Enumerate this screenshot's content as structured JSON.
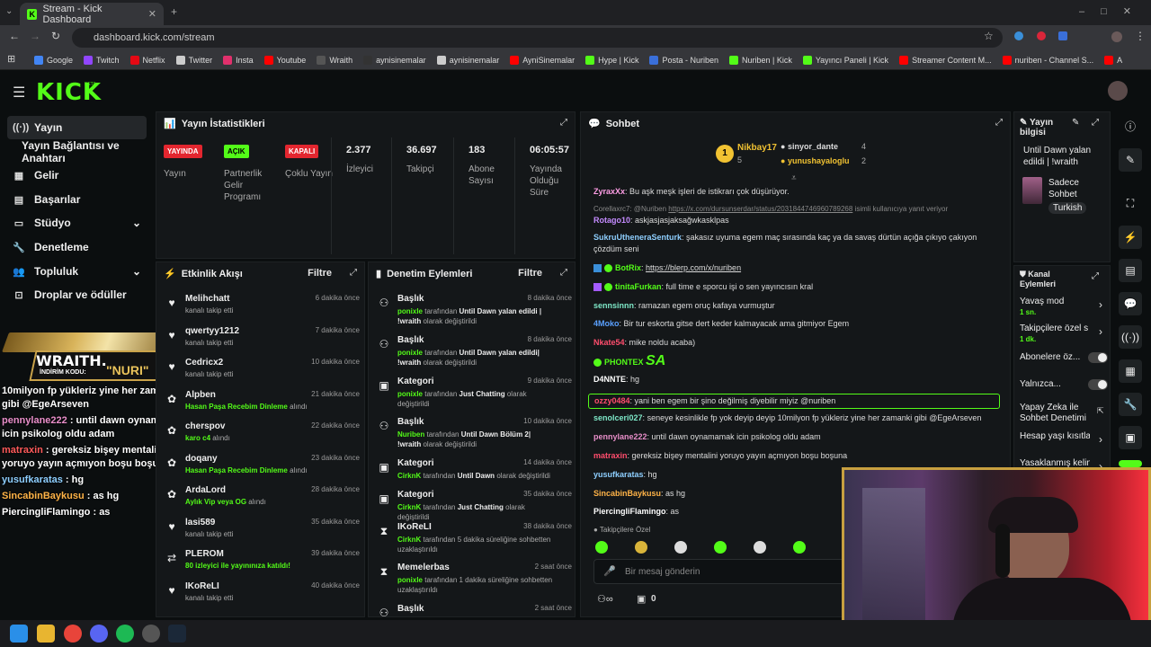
{
  "browser": {
    "tab_title": "Stream - Kick Dashboard",
    "url": "dashboard.kick.com/stream",
    "bookmarks": [
      "Google",
      "Twitch",
      "Netflix",
      "Twitter",
      "Insta",
      "Youtube",
      "Wraith",
      "aynisinemalar",
      "aynisinemalar",
      "AyniSinemalar",
      "Hype | Kick",
      "Posta - Nuriben",
      "Nuriben | Kick",
      "Yayıncı Paneli | Kick",
      "Streamer Content M...",
      "nuriben - Channel S...",
      "Aynı Sinemalar - Ça..."
    ]
  },
  "brand": {
    "logo": "KICK",
    "beta": "BETA",
    "accent": "#53fc18"
  },
  "sidebar": {
    "items": [
      {
        "label": "Yayın",
        "icon": "broadcast-icon"
      },
      {
        "label": "Yayın Bağlantısı ve Anahtarı"
      },
      {
        "label": "Gelir",
        "icon": "revenue-icon"
      },
      {
        "label": "Başarılar",
        "icon": "achievements-icon"
      },
      {
        "label": "Stüdyo",
        "icon": "studio-icon"
      },
      {
        "label": "Denetleme",
        "icon": "moderation-icon"
      },
      {
        "label": "Topluluk",
        "icon": "community-icon"
      },
      {
        "label": "Droplar ve ödüller",
        "icon": "drops-icon"
      }
    ]
  },
  "overlay": {
    "banner_brand": "WRAITH.",
    "banner_code_label": "İNDİRİM KODU:",
    "banner_code": "\"NURI\"",
    "chat": [
      {
        "user": "",
        "text": "10milyon fp yükleriz yine her zamanki gibi @EgeArseven",
        "color": "#ffffff"
      },
      {
        "user": "pennylane222",
        "text": "until dawn oynamamak icin psikolog oldu adam",
        "color": "#e88ec9"
      },
      {
        "user": "matraxin",
        "text": "gereksiz bişey mentalini yoruyo yayın açmıyon boşu boşuna",
        "color": "#ff5a5a"
      },
      {
        "user": "yusufkaratas",
        "text": "hg",
        "color": "#8ecfff"
      },
      {
        "user": "SincabinBaykusu",
        "text": "as hg",
        "color": "#ffb347"
      },
      {
        "user": "PiercingliFlamingo",
        "text": "as",
        "color": "#ffffff"
      }
    ]
  },
  "stats": {
    "title": "Yayın İstatistikleri",
    "badges": [
      {
        "text": "YAYINDA",
        "label": "Yayın",
        "color": "#e3262f"
      },
      {
        "text": "AÇIK",
        "label": "Partnerlik Gelir Programı",
        "color": "#53fc18"
      },
      {
        "text": "KAPALI",
        "label": "Çoklu Yayın",
        "color": "#e3262f"
      }
    ],
    "values": [
      {
        "value": "2.377",
        "label": "İzleyici"
      },
      {
        "value": "36.697",
        "label": "Takipçi"
      },
      {
        "value": "183",
        "label": "Abone Sayısı"
      },
      {
        "value": "06:05:57",
        "label": "Yayında Olduğu Süre"
      }
    ]
  },
  "activity": {
    "title": "Etkinlik Akışı",
    "filter": "Filtre",
    "rows": [
      {
        "name": "Melihchatt",
        "time": "6 dakika önce",
        "sub": "kanalı takip etti",
        "icon": "heart-icon"
      },
      {
        "name": "qwertyy1212",
        "time": "7 dakika önce",
        "sub": "kanalı takip etti",
        "icon": "heart-icon"
      },
      {
        "name": "Cedricx2",
        "time": "10 dakika önce",
        "sub": "kanalı takip etti",
        "icon": "heart-icon"
      },
      {
        "name": "Alpben",
        "time": "21 dakika önce",
        "sub_g": "Hasan Paşa Recebim Dinleme",
        "sub": "alındı",
        "icon": "gift-icon"
      },
      {
        "name": "cherspov",
        "time": "22 dakika önce",
        "sub_g": "karo c4",
        "sub": "alındı",
        "icon": "gift-icon"
      },
      {
        "name": "doqany",
        "time": "23 dakika önce",
        "sub_g": "Hasan Paşa Recebim Dinleme",
        "sub": "alındı",
        "icon": "gift-icon"
      },
      {
        "name": "ArdaLord",
        "time": "28 dakika önce",
        "sub_g": "Aylık Vip veya OG",
        "sub": "alındı",
        "icon": "gift-icon"
      },
      {
        "name": "lasi589",
        "time": "35 dakika önce",
        "sub": "kanalı takip etti",
        "icon": "heart-icon"
      },
      {
        "name": "PLEROM",
        "time": "39 dakika önce",
        "sub_g": "80 izleyici ile yayınınıza katıldı!",
        "sub": "",
        "icon": "host-icon"
      },
      {
        "name": "IKoReLI",
        "time": "40 dakika önce",
        "sub": "kanalı takip etti",
        "icon": "heart-icon"
      }
    ]
  },
  "modlog": {
    "title": "Denetim Eylemleri",
    "filter": "Filtre",
    "rows": [
      {
        "name": "Başlık",
        "time": "8 dakika önce",
        "by": "ponixle",
        "mid": "tarafından",
        "val": "Until Dawn yalan edildi | !wraith",
        "tail": "olarak değiştirildi",
        "icon": "title-icon"
      },
      {
        "name": "Başlık",
        "time": "8 dakika önce",
        "by": "ponixle",
        "mid": "tarafından",
        "val": "Until Dawn yalan edildi| !wraith",
        "tail": "olarak değiştirildi",
        "icon": "title-icon"
      },
      {
        "name": "Kategori",
        "time": "9 dakika önce",
        "by": "ponixle",
        "mid": "tarafından",
        "val": "Just Chatting",
        "tail": "olarak değiştirildi",
        "icon": "category-icon"
      },
      {
        "name": "Başlık",
        "time": "10 dakika önce",
        "by": "Nuriben",
        "mid": "tarafından",
        "val": "Until Dawn Bölüm 2| !wraith",
        "tail": "olarak değiştirildi",
        "icon": "title-icon"
      },
      {
        "name": "Kategori",
        "time": "14 dakika önce",
        "by": "CirknK",
        "mid": "tarafından",
        "val": "Until Dawn",
        "tail": "olarak değiştirildi",
        "icon": "category-icon"
      },
      {
        "name": "Kategori",
        "time": "35 dakika önce",
        "by": "CirknK",
        "mid": "tarafından",
        "val": "Just Chatting",
        "tail": "olarak değiştirildi",
        "icon": "category-icon"
      },
      {
        "name": "IKoReLI",
        "time": "38 dakika önce",
        "by": "CirknK",
        "mid": "tarafından 5 dakika süreliğine sohbetten uzaklaştırıldı",
        "val": "",
        "tail": "",
        "icon": "timeout-icon"
      },
      {
        "name": "Memelerbas",
        "time": "2 saat önce",
        "by": "ponixle",
        "mid": "tarafından 1 dakika süreliğine sohbetten uzaklaştırıldı",
        "val": "",
        "tail": "",
        "icon": "timeout-icon"
      },
      {
        "name": "Başlık",
        "time": "2 saat önce",
        "by": "",
        "mid": "",
        "val": "",
        "tail": "",
        "icon": "title-icon"
      }
    ]
  },
  "chat": {
    "title": "Sohbet",
    "top_gifter": {
      "rank": "1",
      "name": "Nikbay17",
      "count": "5"
    },
    "gifters": [
      {
        "name": "sinyor_dante",
        "count": "4"
      },
      {
        "name": "yunushayaloglu",
        "count": "2"
      }
    ],
    "reply_hint": "Corellaxrc7: @Nuriben",
    "reply_link": "https://x.com/dursunserdar/status/2031844746960789268",
    "reply_tail": "isimli kullanıcıya yanıt veriyor",
    "messages": [
      {
        "user": "ZyraxXx",
        "text": "Bu aşk meşk işleri de istikrarı çok düşürüyor.",
        "color": "#ff9ee6"
      },
      {
        "user": "Rotago10",
        "text": "askjasjasjaksağwkasklpas",
        "color": "#c48bff"
      },
      {
        "user": "SukruUtheneraSenturk",
        "text": "şakasız uyuma egem maç sırasında kaç ya da savaş dürtün açığa çıkıyo çakıyon çözdüm seni",
        "color": "#8ecfff"
      },
      {
        "user": "BotRix",
        "text": "https://blerp.com/x/nuriben",
        "color": "#53fc18"
      },
      {
        "user": "tinitaFurkan",
        "text": "full time e sporcu işi o sen yayıncısın kral",
        "color": "#53fc18"
      },
      {
        "user": "sennsinnn",
        "text": "ramazan egem oruç kafaya vurmuştur",
        "color": "#7ee8c8"
      },
      {
        "user": "4Moko",
        "text": "Bir tur eskorta gitse dert keder kalmayacak ama gitmiyor Egem",
        "color": "#5aa0ff"
      },
      {
        "user": "Nkate54",
        "text": "mike noldu acaba)",
        "color": "#ff4d6d"
      },
      {
        "user": "PHONTEX",
        "text": "SA",
        "color": "#53fc18"
      },
      {
        "user": "D4NNTE",
        "text": "hg",
        "color": "#ffffff"
      },
      {
        "user": "ozzy0484",
        "text": "yani ben egem bir şino değilmiş diyebilir miyiz @nuriben",
        "color": "#ff4d6d"
      },
      {
        "user": "senolceri027",
        "text": "seneye kesinlikle fp yok deyip deyip 10milyon fp yükleriz yine her zamanki gibi @EgeArseven",
        "color": "#7ee8c8"
      },
      {
        "user": "pennylane222",
        "text": "until dawn oynamamak icin psikolog oldu adam",
        "color": "#e88ec9"
      },
      {
        "user": "matraxin",
        "text": "gereksiz bişey mentalini yoruyo yayın açmıyon boşu boşuna",
        "color": "#ff4d6d"
      },
      {
        "user": "yusufkaratas",
        "text": "hg",
        "color": "#8ecfff"
      },
      {
        "user": "SincabinBaykusu",
        "text": "as hg",
        "color": "#ffb347"
      },
      {
        "user": "PiercingliFlamingo",
        "text": "as",
        "color": "#ffffff"
      }
    ],
    "followers_only": "Takipçilere Özel",
    "input_placeholder": "Bir mesaj gönderin",
    "points": "0"
  },
  "info": {
    "title": "Yayın bilgisi",
    "stream_title": "Until Dawn yalan edildi | !wraith",
    "category": "Sadece Sohbet",
    "language": "Turkish"
  },
  "mod_actions": {
    "title": "Kanal Eylemleri",
    "items": [
      {
        "label": "Yavaş mod",
        "sub": "1 sn."
      },
      {
        "label": "Takipçilere özel s",
        "sub": "1 dk."
      },
      {
        "label": "Abonelere öz...",
        "sub": ""
      },
      {
        "label": "Yalnızca...",
        "sub": ""
      },
      {
        "label": "Yapay Zeka ile Sohbet Denetimi",
        "sub": ""
      },
      {
        "label": "Hesap yaşı kısıtla",
        "sub": ""
      },
      {
        "label": "Yasaklanmış kelin",
        "sub": ""
      }
    ]
  }
}
